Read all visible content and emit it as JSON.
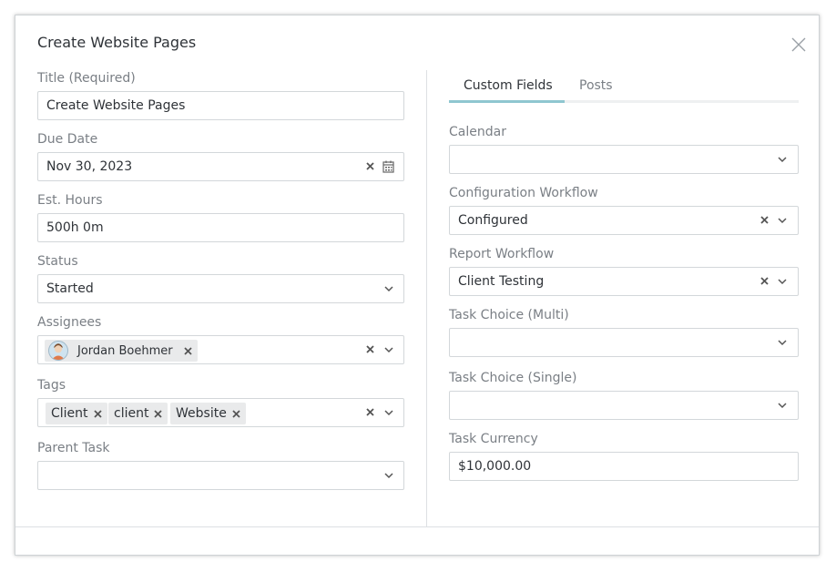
{
  "modal": {
    "title": "Create Website Pages"
  },
  "left": {
    "title_field": {
      "label": "Title (Required)",
      "value": "Create Website Pages"
    },
    "due_date": {
      "label": "Due Date",
      "value": "Nov 30, 2023"
    },
    "est_hours": {
      "label": "Est. Hours",
      "value": "500h 0m"
    },
    "status": {
      "label": "Status",
      "value": "Started"
    },
    "assignees": {
      "label": "Assignees",
      "items": [
        "Jordan Boehmer"
      ]
    },
    "tags": {
      "label": "Tags",
      "items": [
        "Client",
        "client",
        "Website"
      ]
    },
    "parent_task": {
      "label": "Parent Task",
      "value": ""
    }
  },
  "tabs": [
    {
      "label": "Custom Fields",
      "active": true
    },
    {
      "label": "Posts",
      "active": false
    }
  ],
  "right": {
    "calendar": {
      "label": "Calendar",
      "value": ""
    },
    "configuration_workflow": {
      "label": "Configuration Workflow",
      "value": "Configured"
    },
    "report_workflow": {
      "label": "Report Workflow",
      "value": "Client Testing"
    },
    "task_choice_multi": {
      "label": "Task Choice (Multi)",
      "value": ""
    },
    "task_choice_single": {
      "label": "Task Choice (Single)",
      "value": ""
    },
    "task_currency": {
      "label": "Task Currency",
      "value": "$10,000.00"
    }
  },
  "colors": {
    "border": "#d3d7da",
    "label": "#7a7f85",
    "text": "#2f3338",
    "tab_accent": "#8fc6d0",
    "chip": "#e9eaeb"
  },
  "icons": {
    "close": "close-icon",
    "calendar": "calendar-icon",
    "clear": "clear-icon",
    "chevron": "chevron-down-icon"
  }
}
